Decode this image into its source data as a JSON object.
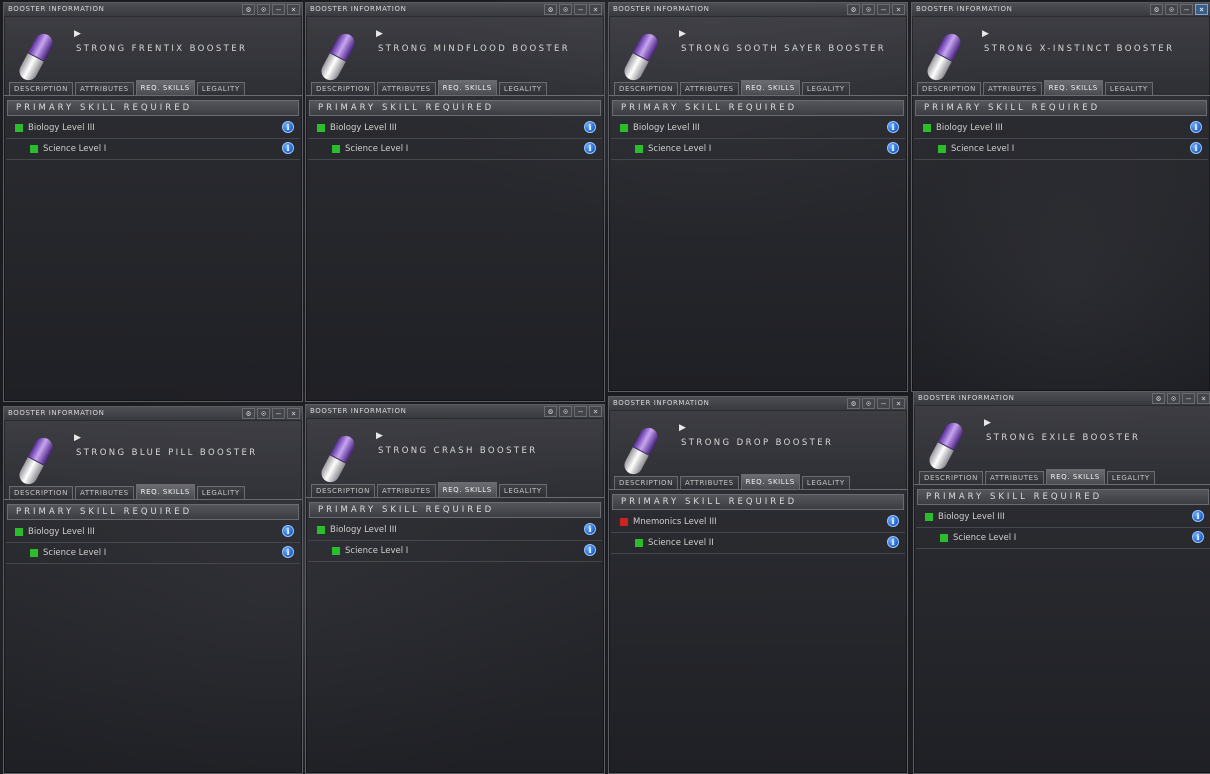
{
  "window_title": "BOOSTER INFORMATION",
  "window_buttons": [
    "⚙",
    "⊙",
    "–",
    "×"
  ],
  "tabs": [
    "DESCRIPTION",
    "ATTRIBUTES",
    "REQ. SKILLS",
    "LEGALITY"
  ],
  "selected_tab": "REQ. SKILLS",
  "section_header": "PRIMARY SKILL REQUIRED",
  "info_glyph": "i",
  "arrow_glyph": "▶",
  "colors": {
    "met": "#2cbd2c",
    "unmet": "#cf2323",
    "info": "#1c5fc5",
    "active_close": "#3b5e86"
  },
  "windows": [
    {
      "name": "STRONG FRENTIX BOOSTER",
      "skills": [
        {
          "label": "Biology Level III",
          "status": "met"
        },
        {
          "label": "Science Level I",
          "status": "met"
        }
      ]
    },
    {
      "name": "STRONG MINDFLOOD BOOSTER",
      "skills": [
        {
          "label": "Biology Level III",
          "status": "met"
        },
        {
          "label": "Science Level I",
          "status": "met"
        }
      ]
    },
    {
      "name": "STRONG SOOTH SAYER BOOSTER",
      "skills": [
        {
          "label": "Biology Level III",
          "status": "met"
        },
        {
          "label": "Science Level I",
          "status": "met"
        }
      ]
    },
    {
      "name": "STRONG X-INSTINCT BOOSTER",
      "skills": [
        {
          "label": "Biology Level III",
          "status": "met"
        },
        {
          "label": "Science Level I",
          "status": "met"
        }
      ]
    },
    {
      "name": "STRONG BLUE PILL BOOSTER",
      "skills": [
        {
          "label": "Biology Level III",
          "status": "met"
        },
        {
          "label": "Science Level I",
          "status": "met"
        }
      ]
    },
    {
      "name": "STRONG CRASH BOOSTER",
      "skills": [
        {
          "label": "Biology Level III",
          "status": "met"
        },
        {
          "label": "Science Level I",
          "status": "met"
        }
      ]
    },
    {
      "name": "STRONG DROP BOOSTER",
      "skills": [
        {
          "label": "Mnemonics Level III",
          "status": "unmet"
        },
        {
          "label": "Science Level II",
          "status": "met"
        }
      ]
    },
    {
      "name": "STRONG EXILE BOOSTER",
      "skills": [
        {
          "label": "Biology Level III",
          "status": "met"
        },
        {
          "label": "Science Level I",
          "status": "met"
        }
      ]
    }
  ]
}
